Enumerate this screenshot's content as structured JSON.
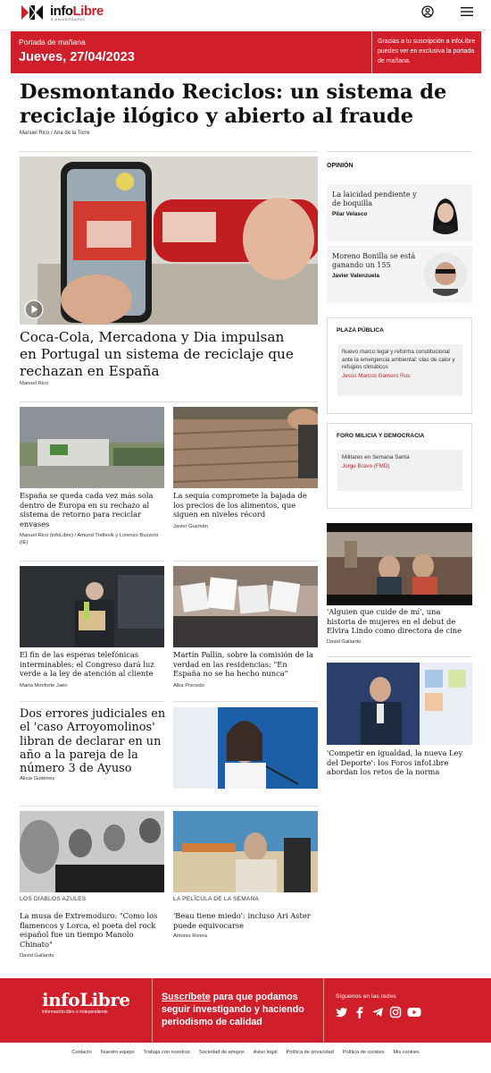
{
  "header": {
    "logo_part1": "info",
    "logo_part2": "Libre",
    "logo_sub": "5 aniversario"
  },
  "banner": {
    "label": "Portada de mañana",
    "date": "Jueves, 27/04/2023",
    "note": "Gracias a tu suscripción a infoLibre puedes ver en exclusiva la portada de mañana."
  },
  "lead": {
    "title": "Desmontando Reciclos: un sistema de reciclaje ilógico y abierto al fraude",
    "authors": "Manuel Rico / Ana de la Torre"
  },
  "featured": {
    "title": "Coca-Cola, Mercadona y Dia impulsan en Portugal un sistema de reciclaje que rechazan en España",
    "author": "Manuel Rico"
  },
  "stories": [
    {
      "title": "España se queda cada vez más sola dentro de Europa en su rechazo al sistema de retorno para reciclar envases",
      "author": "Manuel Rico (infoLibre) / Amund Trellevik y Lorenzo Buzzoni (IE)"
    },
    {
      "title": "La sequía compromete la bajada de los precios de los alimentos, que siguen en niveles récord",
      "author": "Javier Guzmán"
    },
    {
      "title": "El fin de las esperas telefónicas interminables: el Congreso dará luz verde a la ley de atención al cliente",
      "author": "Marta Monforte Jaén"
    },
    {
      "title": "Martín Pallín, sobre la comisión de la verdad en las residencias: \"En España no se ha hecho nunca\"",
      "author": "Alba Precedo"
    },
    {
      "title": "Dos errores judiciales en el 'caso Arroyomolinos' libran de declarar en un año a la pareja de la número 3 de Ayuso",
      "author": "Alicia Gutiérrez"
    },
    {
      "kicker": "Los diablos azules",
      "title": "La musa de Extremoduro: \"Como los flamencos y Lorca, el poeta del rock español fue un tiempo Manolo Chinato\"",
      "author": "David Gallardo"
    },
    {
      "kicker": "La película de la semana",
      "title": "'Beau tiene miedo': incluso Ari Aster puede equivocarse",
      "author": "Antonio Rivera"
    }
  ],
  "sidebar": {
    "opinion_heading": "Opinión",
    "opinion": [
      {
        "title": "La laicidad pendiente y de boquilla",
        "author": "Pilar Velasco"
      },
      {
        "title": "Moreno Bonilla se está ganando un 155",
        "author": "Javier Valenzuela"
      }
    ],
    "plaza": {
      "heading": "Plaza pública",
      "text": "Nuevo marco legal y reforma constitucional ante la emergencia ambiental: olas de calor y refugios climáticos",
      "author": "Jesús Marcos Gamero Rus"
    },
    "foro": {
      "heading": "Foro Milicia y Democracia",
      "text": "Militares en Semana Santa",
      "author": "Jorge Bravo (FMD)"
    },
    "stories": [
      {
        "title": "'Alguien que cuide de mí', una historia de mujeres en el debut de Elvira Lindo como directora de cine",
        "author": "David Gallardo"
      },
      {
        "title": "'Competir en igualdad, la nueva Ley del Deporte': los Foros infoLibre abordan los retos de la norma"
      }
    ]
  },
  "footer": {
    "logo_part1": "info",
    "logo_part2": "Libre",
    "tagline": "información libre e independiente",
    "subscribe_link": "Suscríbete",
    "subscribe_rest": " para que podamos seguir investigando y haciendo periodismo de calidad",
    "follow": "Síguenos en las redes",
    "social": [
      "twitter-icon",
      "facebook-icon",
      "telegram-icon",
      "instagram-icon",
      "youtube-icon"
    ],
    "links": [
      "Contacto",
      "Nuestro equipo",
      "Trabaja con nosotros",
      "Sociedad de amigos",
      "Aviso legal",
      "Política de privacidad",
      "Política de cookies",
      "Mis cookies"
    ]
  },
  "colors": {
    "brand_red": "#d01f2a"
  }
}
